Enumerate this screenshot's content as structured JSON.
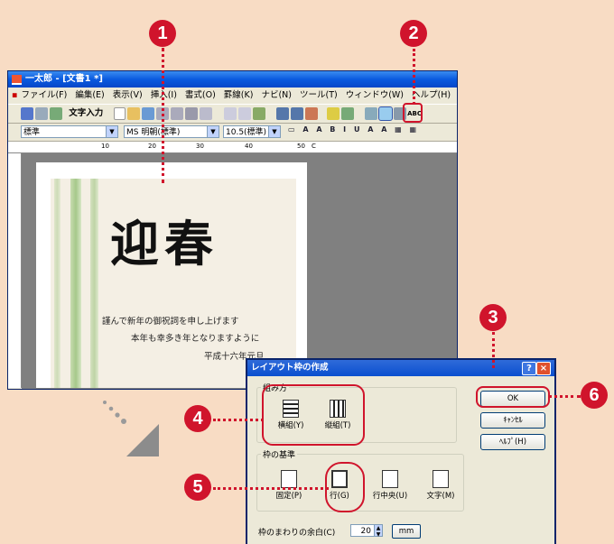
{
  "window": {
    "title": "一太郎 - [文書1 *]",
    "menu": [
      "ファイル(F)",
      "編集(E)",
      "表示(V)",
      "挿入(I)",
      "書式(O)",
      "罫線(K)",
      "ナビ(N)",
      "ツール(T)",
      "ウィンドウ(W)",
      "ヘルプ(H)"
    ],
    "toolbar_text_input": "文字入力",
    "style_combo": "標準",
    "font_combo": "MS 明朝(標準)",
    "size_combo": "10.5(標準)",
    "ruler_marks": [
      "10",
      "20",
      "30",
      "40",
      "50",
      "C"
    ]
  },
  "card": {
    "heading": "迎春",
    "lines": [
      "謹んで新年の御祝詞を申し上げます",
      "本年も幸多き年となりますように",
      "平成十六年元旦"
    ]
  },
  "dialog": {
    "title": "レイアウト枠の作成",
    "help": "?",
    "close": "×",
    "group_kumi": "組み方",
    "yoko": "横組(Y)",
    "tate": "縦組(T)",
    "group_kijun": "枠の基準",
    "kotei": "固定(P)",
    "gyo": "行(G)",
    "gyochuo": "行中央(U)",
    "moji": "文字(M)",
    "ok": "OK",
    "cancel": "ｷｬﾝｾﾙ",
    "helpbtn": "ﾍﾙﾌﾟ(H)",
    "margin_label": "枠のまわりの余白(C)",
    "margin_value": "20",
    "margin_unit": "mm"
  },
  "callouts": [
    "1",
    "2",
    "3",
    "4",
    "5",
    "6"
  ],
  "colors": {
    "callout": "#d0142c",
    "background": "#f8dcc4"
  }
}
